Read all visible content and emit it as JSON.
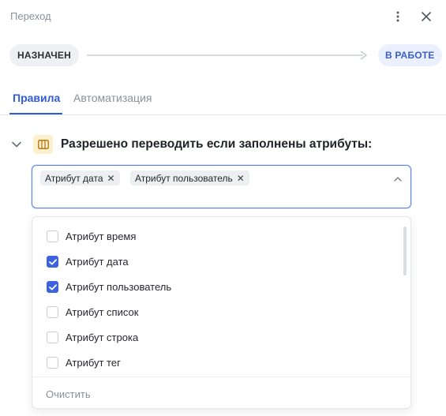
{
  "header": {
    "title": "Переход"
  },
  "flow": {
    "from_status": "НАЗНАЧЕН",
    "to_status": "В РАБОТЕ"
  },
  "tabs": [
    {
      "label": "Правила",
      "active": true
    },
    {
      "label": "Автоматизация",
      "active": false
    }
  ],
  "rule": {
    "text": "Разрешено переводить если заполнены атрибуты:",
    "icon": "columns-icon"
  },
  "select": {
    "chips": [
      {
        "label": "Атрибут дата"
      },
      {
        "label": "Атрибут пользователь"
      }
    ]
  },
  "options": [
    {
      "label": "Атрибут время",
      "checked": false
    },
    {
      "label": "Атрибут дата",
      "checked": true
    },
    {
      "label": "Атрибут пользователь",
      "checked": true
    },
    {
      "label": "Атрибут список",
      "checked": false
    },
    {
      "label": "Атрибут строка",
      "checked": false
    },
    {
      "label": "Атрибут тег",
      "checked": false
    }
  ],
  "footer": {
    "clear_label": "Очистить"
  },
  "colors": {
    "accent": "#3d63e0",
    "tab_active": "#2f5bd8",
    "status_to_bg": "#eaf0fd",
    "status_from_bg": "#eef0f3",
    "attribute_icon_bg": "#fdf0cf"
  }
}
